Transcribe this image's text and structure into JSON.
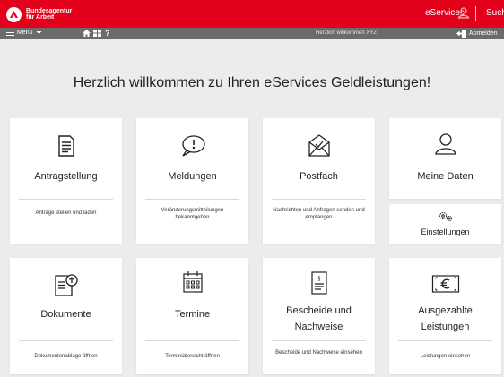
{
  "header": {
    "logo_line1": "Bundesagentur",
    "logo_line2": "für Arbeit",
    "eservices_label": "eServices",
    "search_label": "Suche"
  },
  "menubar": {
    "menu_label": "Menü",
    "help_label": "?",
    "welcome_text": "Herzlich willkommen  XYZ",
    "logout_label": "Abmelden"
  },
  "main": {
    "headline": "Herzlich willkommen zu Ihren eServices Geldleistungen!"
  },
  "tiles": [
    {
      "title": "Antragstellung",
      "desc": "Anträge stellen und laden",
      "icon": "document-icon"
    },
    {
      "title": "Meldungen",
      "desc": "Veränderungsmitteilungen bekanntgeben",
      "icon": "speech-bubble-icon"
    },
    {
      "title": "Postfach",
      "desc": "Nachrichten und Anfragen senden und empfangen",
      "icon": "envelope-icon"
    },
    {
      "title": "Meine Daten",
      "icon": "user-icon"
    },
    {
      "title": "Einstellungen",
      "icon": "gears-icon"
    },
    {
      "title": "Dokumente",
      "desc": "Dokumentenablage öffnen",
      "icon": "document-upload-icon"
    },
    {
      "title": "Termine",
      "desc": "Terminübersicht öffnen",
      "icon": "calendar-icon"
    },
    {
      "title": "Bescheide und Nachweise",
      "desc": "Bescheide und Nachweise einsehen",
      "icon": "paragraph-document-icon"
    },
    {
      "title": "Ausgezahlte Leistungen",
      "desc": "Leistungen einsehen",
      "icon": "euro-note-icon"
    }
  ],
  "colors": {
    "brand_red": "#e2001a",
    "menubar_gray": "#6b6b6b",
    "background": "#ececec"
  }
}
